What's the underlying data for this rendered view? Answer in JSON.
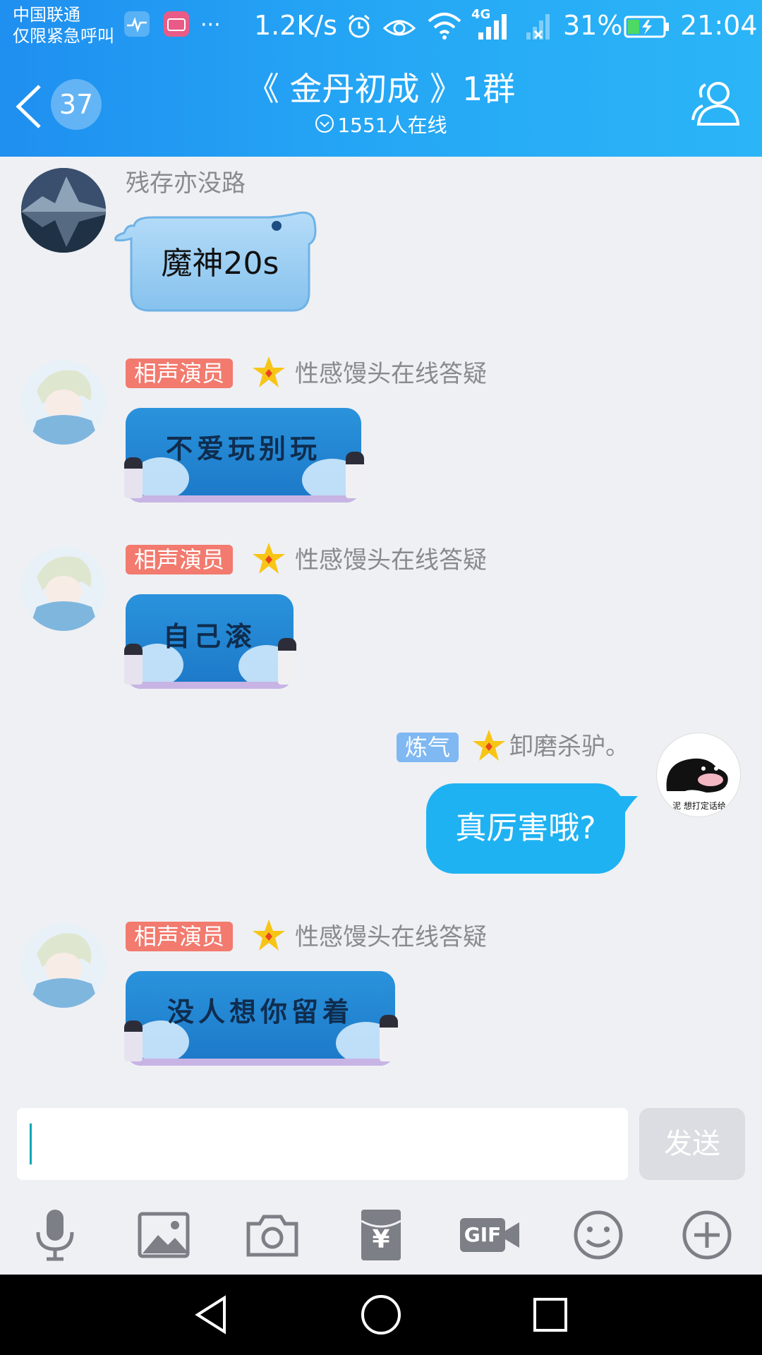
{
  "status_bar": {
    "carrier_line1": "中国联通",
    "carrier_line2": "仅限紧急呼叫",
    "more_dots": "···",
    "net_speed": "1.2K/s",
    "network_type": "4G",
    "battery": "31%",
    "time": "21:04"
  },
  "header": {
    "back_count": "37",
    "title": "《 金丹初成 》1群",
    "online_count": "1551人在线"
  },
  "messages": [
    {
      "sender": "残存亦没路",
      "text": "魔神20s",
      "side": "left",
      "style": "cartoon-bubble"
    },
    {
      "badge": "相声演员",
      "sender": "性感馒头在线答疑",
      "text": "不爱玩别玩",
      "side": "left",
      "style": "image-bubble"
    },
    {
      "badge": "相声演员",
      "sender": "性感馒头在线答疑",
      "text": "自己滚",
      "side": "left",
      "style": "image-bubble"
    },
    {
      "badge": "炼气",
      "sender": "卸磨杀驴。",
      "text": "真厉害哦?",
      "side": "right",
      "style": "plain-bubble",
      "avatar_caption": "泥 想打定话给"
    },
    {
      "badge": "相声演员",
      "sender": "性感馒头在线答疑",
      "text": "没人想你留着",
      "side": "left",
      "style": "image-bubble"
    }
  ],
  "input": {
    "value": "",
    "send_label": "发送"
  },
  "toolbar": {
    "gif_label": "GIF",
    "yuan_symbol": "¥"
  },
  "colors": {
    "header_start": "#1f8ff0",
    "header_end": "#2bb5f7",
    "my_bubble": "#1fb2f3",
    "badge_red": "#f27a6e",
    "badge_blue": "#7fb8f2",
    "chat_bg": "#eff0f4"
  },
  "icons": [
    "back-chevron-icon",
    "contacts-icon",
    "dropdown-circle-icon",
    "star-icon",
    "microphone-icon",
    "image-icon",
    "camera-icon",
    "red-packet-icon",
    "gif-video-icon",
    "emoji-icon",
    "plus-circle-icon",
    "nav-back-icon",
    "nav-home-icon",
    "nav-recent-icon"
  ]
}
